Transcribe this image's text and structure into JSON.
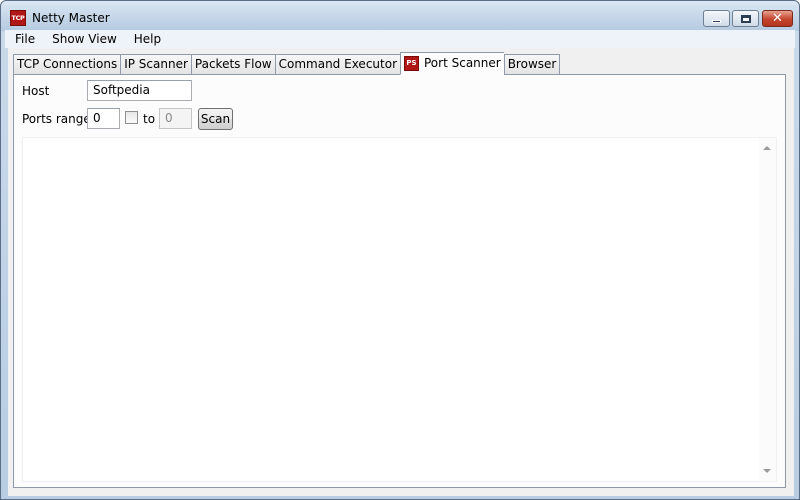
{
  "window": {
    "title": "Netty Master",
    "app_icon_text": "TCP",
    "close_glyph": "✕"
  },
  "menu": [
    "File",
    "Show View",
    "Help"
  ],
  "tabs": [
    {
      "label": "TCP Connections"
    },
    {
      "label": "IP Scanner"
    },
    {
      "label": "Packets Flow"
    },
    {
      "label": "Command Executor"
    },
    {
      "label": "Port Scanner",
      "icon_text": "PS",
      "active": true
    },
    {
      "label": "Browser"
    }
  ],
  "port_scanner": {
    "host_label": "Host",
    "host_value": "Softpedia",
    "ports_label": "Ports range",
    "from_value": "0",
    "checkbox_checked": false,
    "to_label": "to",
    "to_value": "0",
    "scan_label": "Scan",
    "output_text": ""
  },
  "colors": {
    "icon_red": "#b01616",
    "titlebar": "#c4d6e8",
    "close_button": "#c5462f"
  }
}
